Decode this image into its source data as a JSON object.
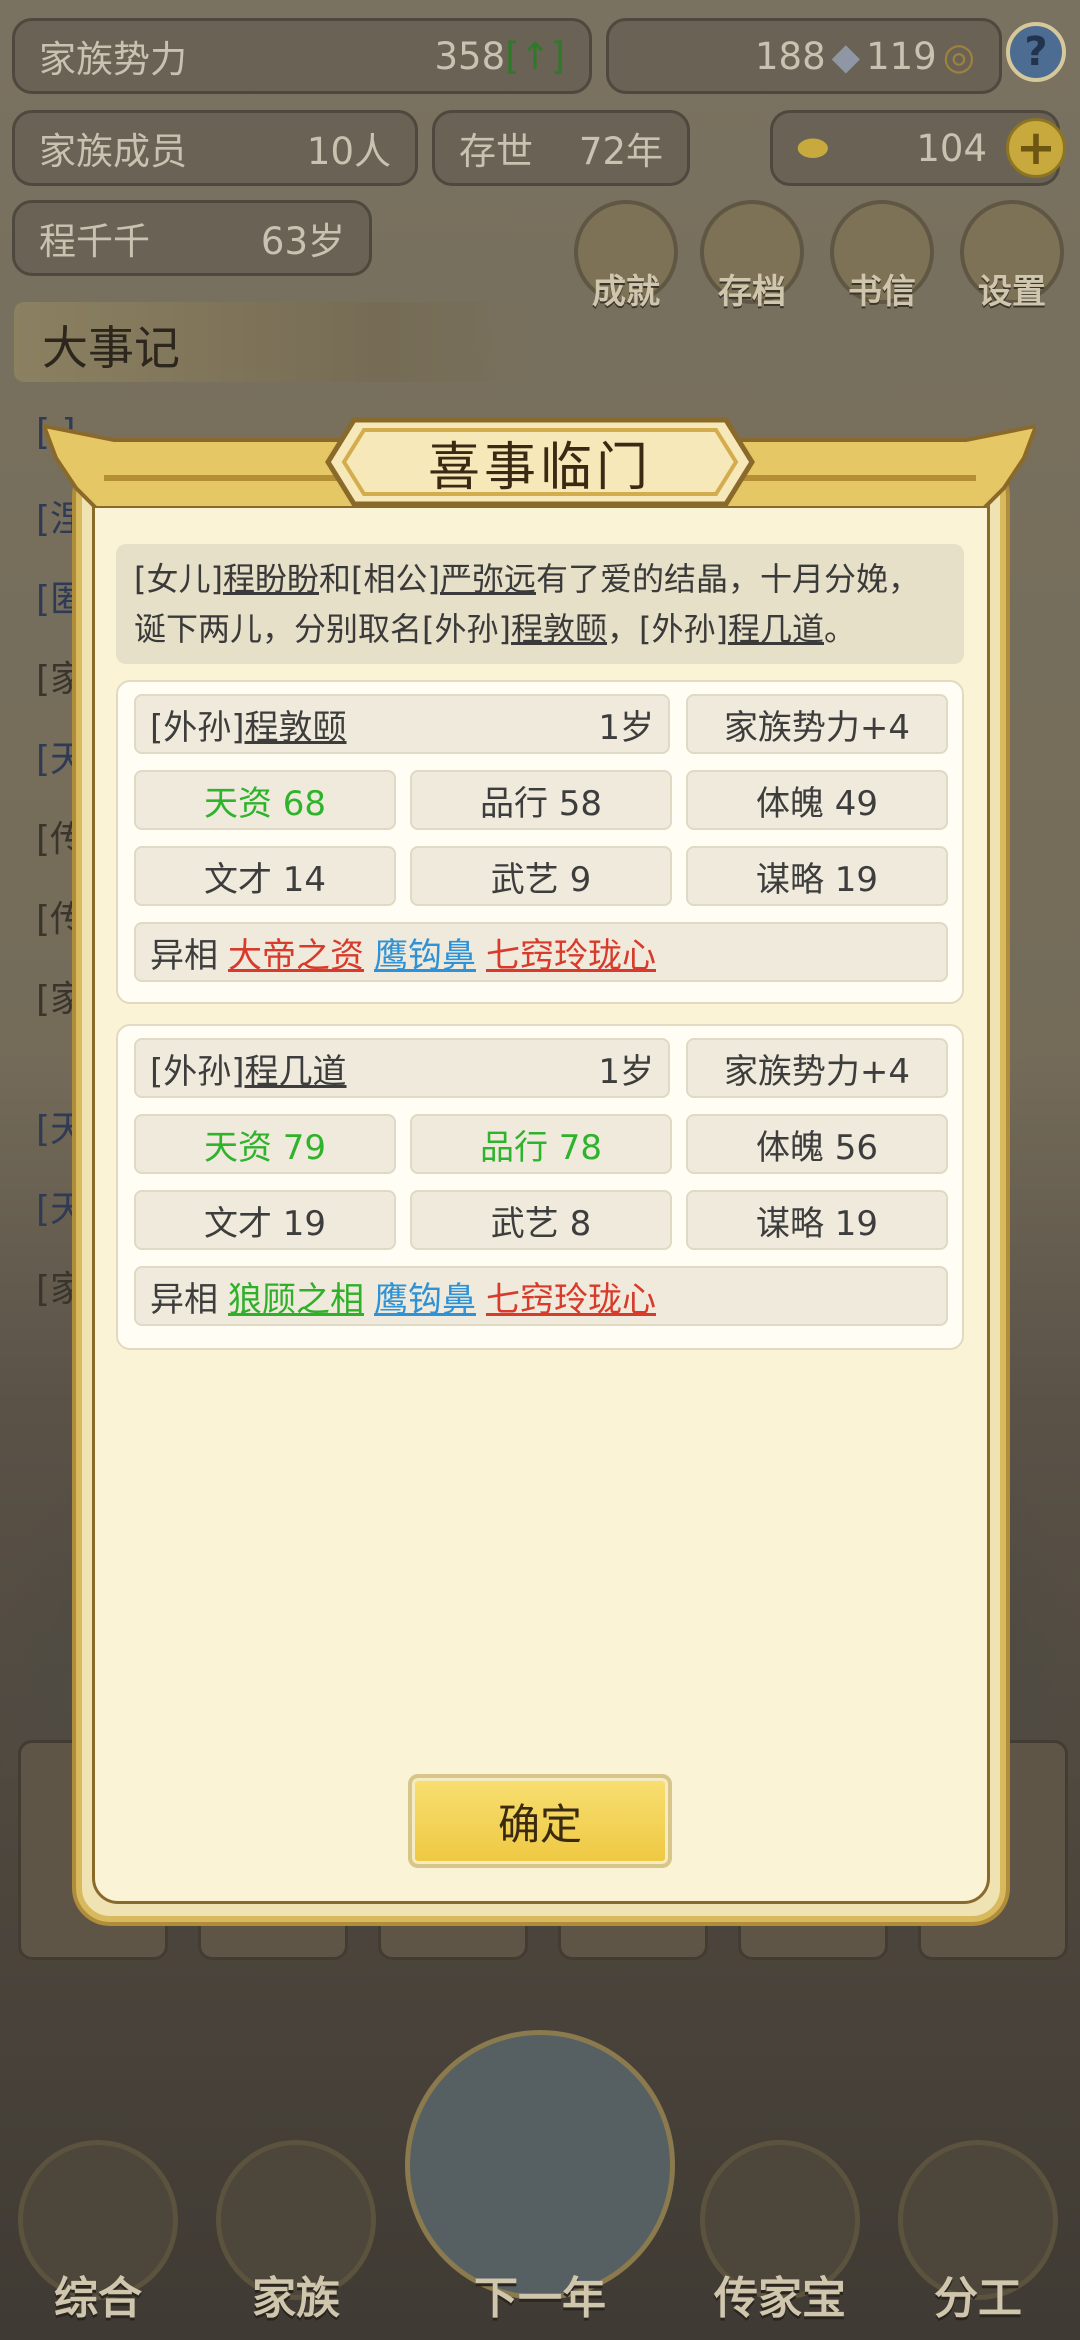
{
  "header": {
    "family_power": {
      "label": "家族势力",
      "value": "358",
      "badge": "[↑]"
    },
    "currency": {
      "silver": "188",
      "coins": "119"
    },
    "members": {
      "label": "家族成员",
      "value": "10人"
    },
    "existence": {
      "label": "存世",
      "value": "72年"
    },
    "gold": "104",
    "patriarch": {
      "name": "程千千",
      "age": "63岁"
    }
  },
  "top_buttons": [
    {
      "label": "成就",
      "icon": "achievement-icon"
    },
    {
      "label": "存档",
      "icon": "save-icon"
    },
    {
      "label": "书信",
      "icon": "letter-icon"
    },
    {
      "label": "设置",
      "icon": "settings-icon"
    }
  ],
  "log": {
    "title": "大事记",
    "visible_fragments": [
      "[ ]",
      "[涅",
      "[匿",
      "[家",
      "[天",
      "[传",
      "[传",
      "[家",
      "[天",
      "[天",
      "[家"
    ]
  },
  "bottom_nav": [
    {
      "label": "综合"
    },
    {
      "label": "家族"
    },
    {
      "label": "下一年"
    },
    {
      "label": "传家宝"
    },
    {
      "label": "分工"
    }
  ],
  "dialog": {
    "title": "喜事临门",
    "announcement": {
      "p1": "[女儿]",
      "daughter": "程盼盼",
      "p2": "和[相公]",
      "husband": "严弥远",
      "p3": "有了爱的结晶，十月分娩，诞下两儿，分别取名[外孙]",
      "child1": "程敦颐",
      "p4": "，[外孙]",
      "child2": "程几道",
      "p5": "。"
    },
    "children": [
      {
        "relation": "[外孙]",
        "name": "程敦颐",
        "age": "1岁",
        "power": "家族势力+4",
        "stats": {
          "talent": "天资 68",
          "conduct": "品行 58",
          "physique": "体魄 49",
          "literary": "文才 14",
          "martial": "武艺 9",
          "strategy": "谋略 19"
        },
        "traits_label": "异相",
        "traits": [
          "大帝之资",
          "鹰钩鼻",
          "七窍玲珑心"
        ],
        "trait_colors": [
          "#d83a2b",
          "#2f92d6",
          "#d83a2b"
        ]
      },
      {
        "relation": "[外孙]",
        "name": "程几道",
        "age": "1岁",
        "power": "家族势力+4",
        "stats": {
          "talent": "天资 79",
          "conduct": "品行 78",
          "physique": "体魄 56",
          "literary": "文才 19",
          "martial": "武艺 8",
          "strategy": "谋略 19"
        },
        "traits_label": "异相",
        "traits": [
          "狼顾之相",
          "鹰钩鼻",
          "七窍玲珑心"
        ],
        "trait_colors": [
          "#30b02a",
          "#2f92d6",
          "#d83a2b"
        ]
      }
    ],
    "confirm_label": "确定"
  },
  "colors": {
    "highlight_green": "#2fb32c",
    "dialog_bg": "#faf3d6",
    "gold_button": "#f2cf4c"
  }
}
